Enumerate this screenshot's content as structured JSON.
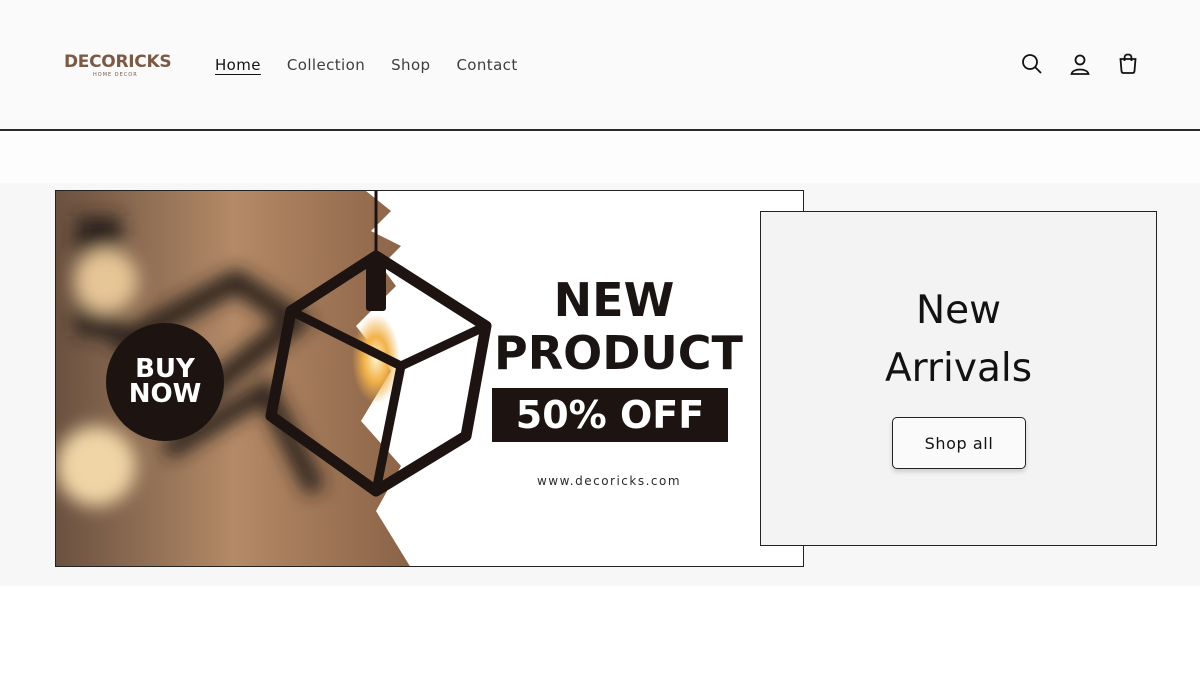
{
  "brand": {
    "logo_text": "DECORICKS",
    "logo_sub": "HOME DECOR"
  },
  "nav": {
    "items": [
      {
        "label": "Home",
        "active": true
      },
      {
        "label": "Collection",
        "active": false
      },
      {
        "label": "Shop",
        "active": false
      },
      {
        "label": "Contact",
        "active": false
      }
    ]
  },
  "header_icons": [
    "search-icon",
    "account-icon",
    "cart-icon"
  ],
  "banner": {
    "buy_now_line1": "BUY",
    "buy_now_line2": "NOW",
    "headline_line1": "NEW",
    "headline_line2": "PRODUCT",
    "discount": "50% OFF",
    "url": "www.decoricks.com"
  },
  "promo": {
    "title_line1": "New",
    "title_line2": "Arrivals",
    "button_label": "Shop all"
  },
  "colors": {
    "brand_brown": "#7a5a45",
    "dark": "#1d1411",
    "header_bg": "#fafafa"
  }
}
